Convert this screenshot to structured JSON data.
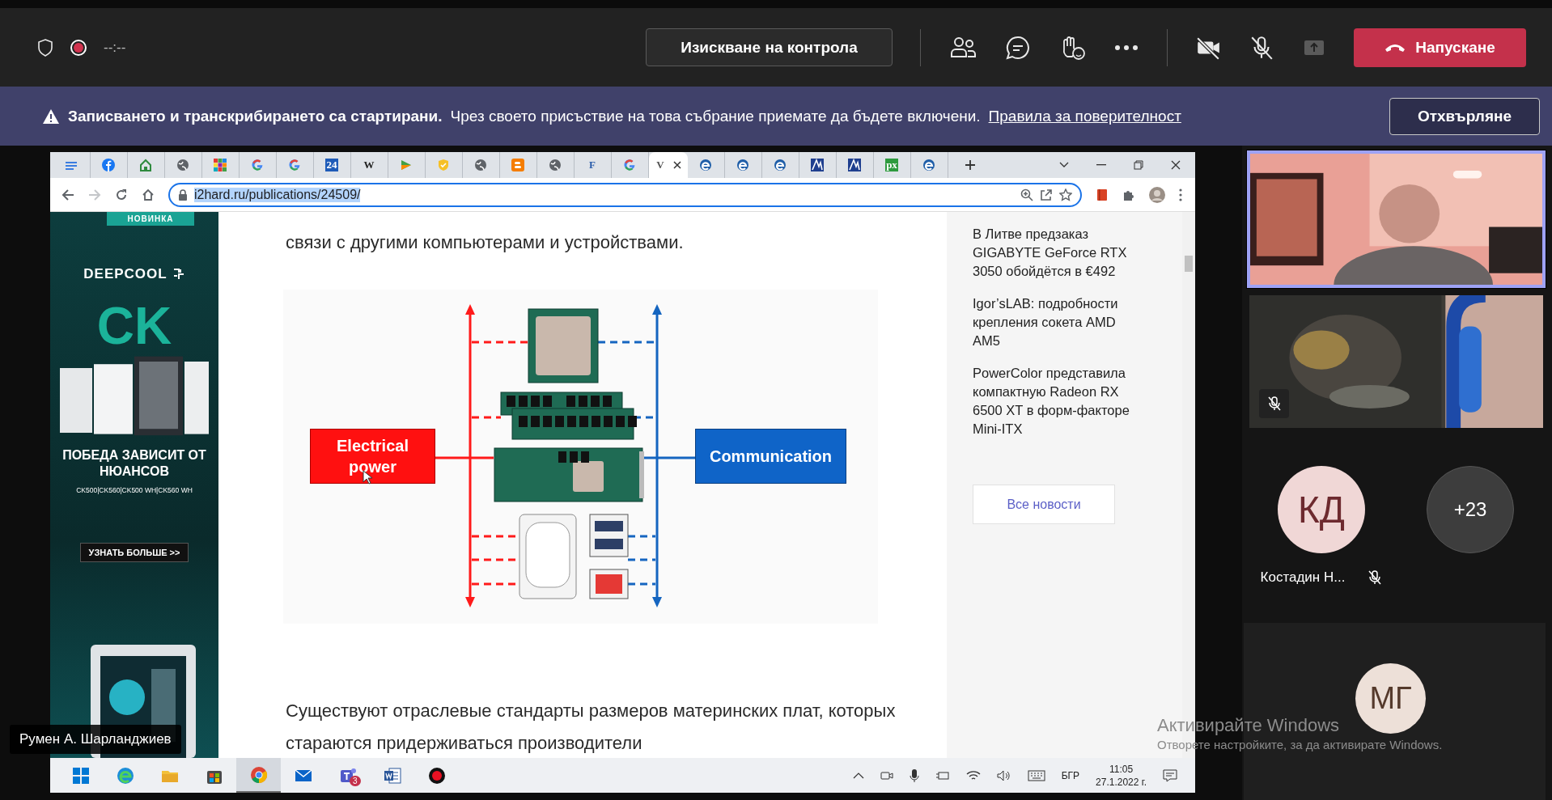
{
  "meeting_bar": {
    "recording": true,
    "timer": "--:--",
    "control_request": "Изискване на контрола",
    "camera_on": false,
    "mic_on": false,
    "share_disabled": true,
    "leave": "Напускане"
  },
  "banner": {
    "title": "Записването и транскрибирането са стартирани.",
    "text": "Чрез своето присъствие на това събрание приемате да бъдете включени.",
    "link": "Правила за поверителност",
    "dismiss": "Отхвърляне"
  },
  "browser": {
    "tabs": [
      {
        "kind": "lines",
        "selected": false
      },
      {
        "kind": "facebook",
        "selected": false
      },
      {
        "kind": "home",
        "selected": false
      },
      {
        "kind": "globe",
        "selected": false
      },
      {
        "kind": "grid",
        "selected": false
      },
      {
        "kind": "google",
        "selected": false
      },
      {
        "kind": "google",
        "selected": false
      },
      {
        "kind": "text",
        "glyph": "24",
        "color": "#1e5bb8",
        "selected": false
      },
      {
        "kind": "text",
        "glyph": "W",
        "color": "#222222",
        "selected": false
      },
      {
        "kind": "flag",
        "selected": false
      },
      {
        "kind": "shield",
        "selected": false
      },
      {
        "kind": "globe",
        "selected": false
      },
      {
        "kind": "blogger",
        "selected": false
      },
      {
        "kind": "globe",
        "selected": false
      },
      {
        "kind": "text",
        "glyph": "F",
        "color": "#2a5caa",
        "selected": false
      },
      {
        "kind": "google",
        "selected": false
      },
      {
        "kind": "text",
        "glyph": "V",
        "color": "#555555",
        "selected": true
      },
      {
        "kind": "edge",
        "selected": false
      },
      {
        "kind": "edge",
        "selected": false
      },
      {
        "kind": "edge",
        "selected": false
      },
      {
        "kind": "logo",
        "selected": false
      },
      {
        "kind": "logo",
        "selected": false
      },
      {
        "kind": "text",
        "glyph": "px",
        "color": "#2e9a3e",
        "selected": false
      },
      {
        "kind": "edge",
        "selected": false
      }
    ],
    "forward_disabled": true,
    "url": "i2hard.ru/publications/24509/",
    "url_selected": true
  },
  "page": {
    "ad": {
      "badge": "НОВИНКА",
      "brand": "DEEPCOOL",
      "big": "CK",
      "headline": "ПОБЕДА ЗАВИСИТ ОТ НЮАНСОВ",
      "models": "CK500|CK560|CK500 WH|CK560 WH",
      "cta": "УЗНАТЬ БОЛЬШЕ >>"
    },
    "paragraphs_before": [
      "связи с другими компьютерами и устройствами."
    ],
    "diagram": {
      "power": "Electrical power",
      "communication": "Communication"
    },
    "paragraphs_after": [
      "Существуют отраслевые стандарты размеров материнских плат, которых стараются придерживаться производители"
    ],
    "news": [
      "В Литве предзаказ GIGABYTE GeForce RTX 3050 обойдётся в €492",
      "Igor’sLAB: подробности крепления сокета AMD AM5",
      "PowerColor представила компактную Radeon RX 6500 XT в форм-факторе Mini-ITX"
    ],
    "all_news": "Все новости"
  },
  "taskbar": {
    "apps": [
      {
        "kind": "start",
        "active": false
      },
      {
        "kind": "edge",
        "active": false
      },
      {
        "kind": "folder",
        "active": false
      },
      {
        "kind": "store",
        "active": false
      },
      {
        "kind": "chrome",
        "active": true
      },
      {
        "kind": "mail",
        "active": false
      },
      {
        "kind": "teams",
        "active": false,
        "badge": "3"
      },
      {
        "kind": "word",
        "active": false
      },
      {
        "kind": "record",
        "active": false
      }
    ],
    "language": "БГР",
    "time": "11:05",
    "date": "27.1.2022 г."
  },
  "presenter": "Румен А. Шарланджиев",
  "participants": {
    "videos": [
      {
        "speaking": true,
        "muted": false
      },
      {
        "speaking": false,
        "muted": true
      }
    ],
    "avatars": [
      {
        "initials": "КД",
        "name": "Костадин Н...",
        "muted": true,
        "kind": "person"
      },
      {
        "initials": "+23",
        "kind": "more"
      }
    ],
    "bottom_avatar": {
      "initials": "МГ"
    }
  },
  "activation": {
    "title": "Активирайте Windows",
    "text": "Отворете настройките, за да активирате Windows."
  }
}
